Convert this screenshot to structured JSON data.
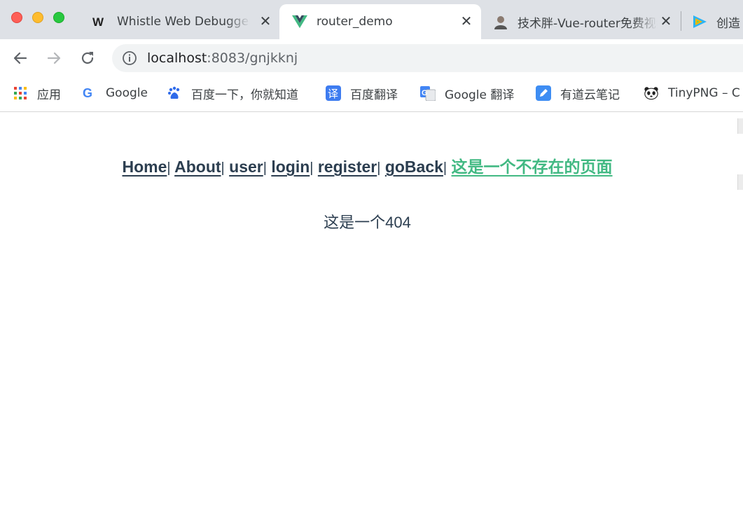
{
  "tabs": [
    {
      "title": "Whistle Web Debugger",
      "icon": "whistle-icon"
    },
    {
      "title": "router_demo",
      "icon": "vue-icon",
      "active": true
    },
    {
      "title": "技术胖-Vue-router免费视频教程",
      "icon": "avatar-icon"
    },
    {
      "title": "创造",
      "icon": "tencent-video-icon"
    }
  ],
  "toolbar": {
    "url_host": "localhost",
    "url_rest": ":8083/gnjkknj"
  },
  "bookmarks": [
    {
      "label": "应用",
      "icon": "apps-grid-icon"
    },
    {
      "label": "Google",
      "icon": "google-icon"
    },
    {
      "label": "百度一下，你就知道",
      "icon": "baidu-icon"
    },
    {
      "label": "百度翻译",
      "icon": "baidu-translate-icon"
    },
    {
      "label": "Google 翻译",
      "icon": "google-translate-icon"
    },
    {
      "label": "有道云笔记",
      "icon": "youdao-note-icon"
    },
    {
      "label": "TinyPNG – C",
      "icon": "tinypng-panda-icon"
    }
  ],
  "nav": {
    "links": [
      "Home",
      "About",
      "user",
      "login",
      "register",
      "goBack"
    ],
    "active_link": "这是一个不存在的页面",
    "separator": "|"
  },
  "content": {
    "message": "这是一个404"
  },
  "colors": {
    "vue_green": "#42b983",
    "text_dark": "#2c3e50",
    "tabstrip_bg": "#dee1e6"
  }
}
